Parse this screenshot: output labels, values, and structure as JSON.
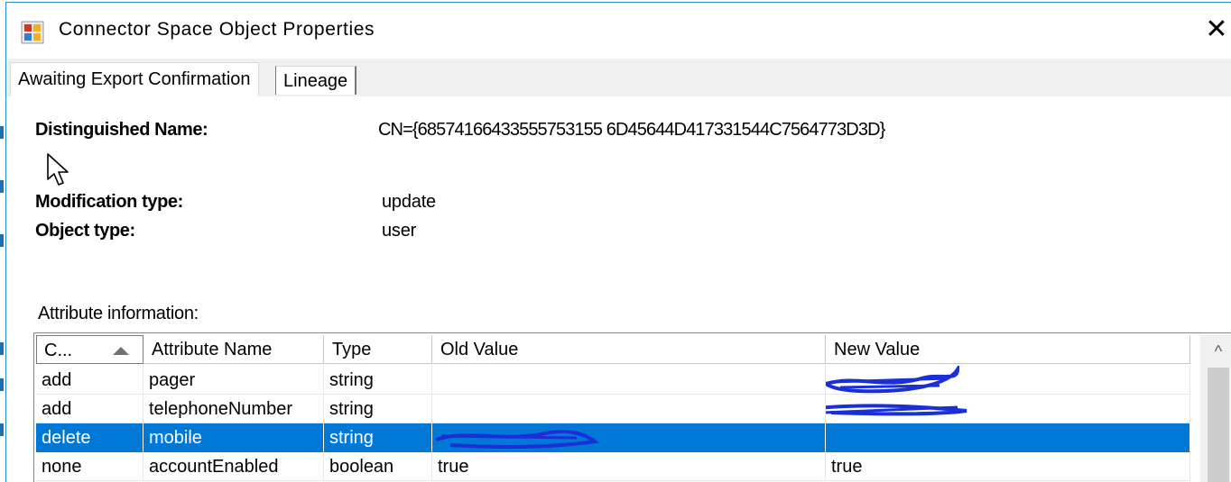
{
  "window": {
    "title": "Connector Space Object Properties",
    "close_glyph": "✕"
  },
  "tabs": [
    {
      "label": "Awaiting Export Confirmation",
      "active": true
    },
    {
      "label": "Lineage",
      "active": false
    }
  ],
  "fields": {
    "dn_label": "Distinguished Name:",
    "dn_value": "CN={68574166433555753155 6D45644D417331544C7564773D3D}",
    "modtype_label": "Modification type:",
    "modtype_value": "update",
    "objtype_label": "Object type:",
    "objtype_value": "user"
  },
  "attributes": {
    "section_label": "Attribute information:",
    "columns": [
      "C...",
      "Attribute Name",
      "Type",
      "Old Value",
      "New Value"
    ],
    "rows": [
      {
        "change": "add",
        "name": "pager",
        "type": "string",
        "old": "",
        "new": "",
        "selected": false
      },
      {
        "change": "add",
        "name": "telephoneNumber",
        "type": "string",
        "old": "",
        "new": "",
        "selected": false
      },
      {
        "change": "delete",
        "name": "mobile",
        "type": "string",
        "old": "",
        "new": "",
        "selected": true
      },
      {
        "change": "none",
        "name": "accountEnabled",
        "type": "boolean",
        "old": "true",
        "new": "true",
        "selected": false
      }
    ],
    "scroll_up_glyph": "^"
  },
  "colors": {
    "selection": "#0078d7",
    "redaction": "#1a2fd6",
    "window_border": "#2b8bd0"
  },
  "icons": [
    "app-icon",
    "mouse-cursor-icon",
    "sort-ascending-icon",
    "close-icon",
    "scroll-up-icon"
  ]
}
